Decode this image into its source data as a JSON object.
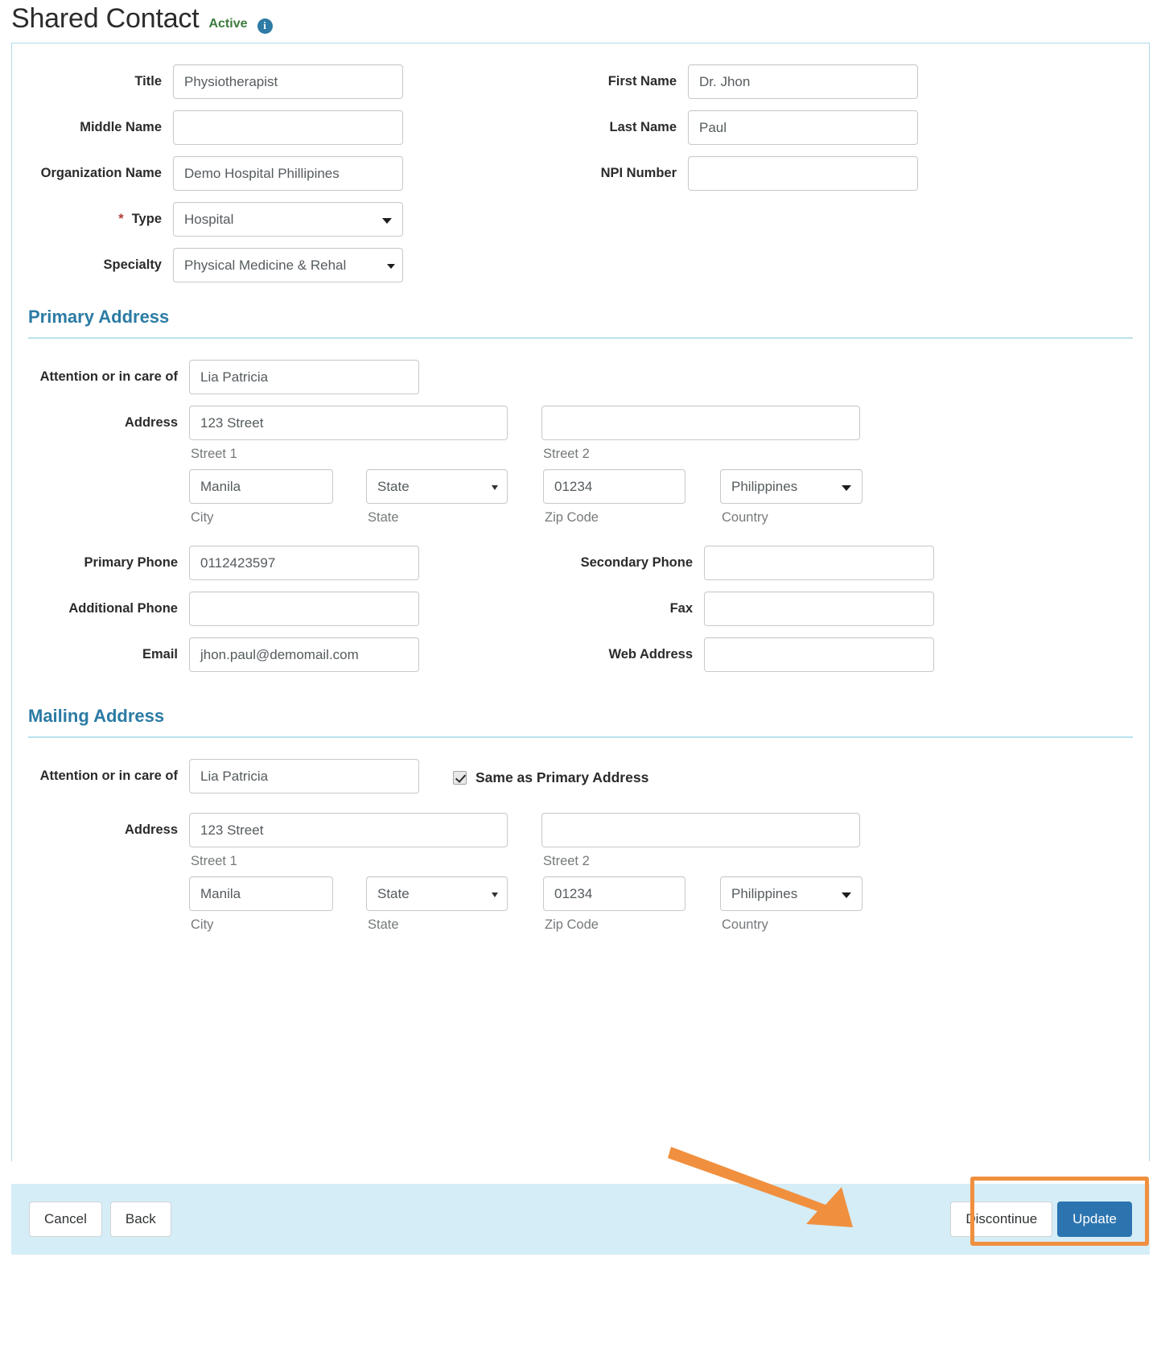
{
  "header": {
    "title": "Shared Contact",
    "status": "Active",
    "info_icon": "info-icon",
    "info_glyph": "i"
  },
  "contact": {
    "title_label": "Title",
    "title_value": "Physiotherapist",
    "first_name_label": "First Name",
    "first_name_value": "Dr. Jhon",
    "middle_name_label": "Middle Name",
    "middle_name_value": "",
    "last_name_label": "Last Name",
    "last_name_value": "Paul",
    "organization_label": "Organization Name",
    "organization_value": "Demo Hospital Phillipines",
    "npi_label": "NPI Number",
    "npi_value": "",
    "type_label": "Type",
    "type_required_marker": "*",
    "type_value": "Hospital",
    "specialty_label": "Specialty",
    "specialty_value": "Physical Medicine & Rehal"
  },
  "primary_address": {
    "section_title": "Primary Address",
    "attention_label": "Attention or in care of",
    "attention_value": "Lia Patricia",
    "address_label": "Address",
    "street1_value": "123 Street",
    "street1_caption": "Street 1",
    "street2_value": "",
    "street2_caption": "Street 2",
    "city_value": "Manila",
    "city_caption": "City",
    "state_value": "State",
    "state_caption": "State",
    "zip_value": "01234",
    "zip_caption": "Zip Code",
    "country_value": "Philippines",
    "country_caption": "Country",
    "primary_phone_label": "Primary Phone",
    "primary_phone_value": "0112423597",
    "secondary_phone_label": "Secondary Phone",
    "secondary_phone_value": "",
    "additional_phone_label": "Additional Phone",
    "additional_phone_value": "",
    "fax_label": "Fax",
    "fax_value": "",
    "email_label": "Email",
    "email_value": "jhon.paul@demomail.com",
    "web_label": "Web Address",
    "web_value": ""
  },
  "mailing_address": {
    "section_title": "Mailing Address",
    "attention_label": "Attention or in care of",
    "attention_value": "Lia Patricia",
    "same_as_primary_label": "Same as Primary Address",
    "same_as_primary_checked": true,
    "address_label": "Address",
    "street1_value": "123 Street",
    "street1_caption": "Street 1",
    "street2_value": "",
    "street2_caption": "Street 2",
    "city_value": "Manila",
    "city_caption": "City",
    "state_value": "State",
    "state_caption": "State",
    "zip_value": "01234",
    "zip_caption": "Zip Code",
    "country_value": "Philippines",
    "country_caption": "Country"
  },
  "footer": {
    "cancel_label": "Cancel",
    "back_label": "Back",
    "discontinue_label": "Discontinue",
    "update_label": "Update"
  },
  "colors": {
    "accent_blue": "#2b7ba4",
    "primary_button": "#2b74b0",
    "footer_bar": "#d5edf7",
    "panel_border": "#aedbe8",
    "annotation_orange": "#f0903f",
    "status_green": "#3c7a3c",
    "required_red": "#b33a3a"
  }
}
